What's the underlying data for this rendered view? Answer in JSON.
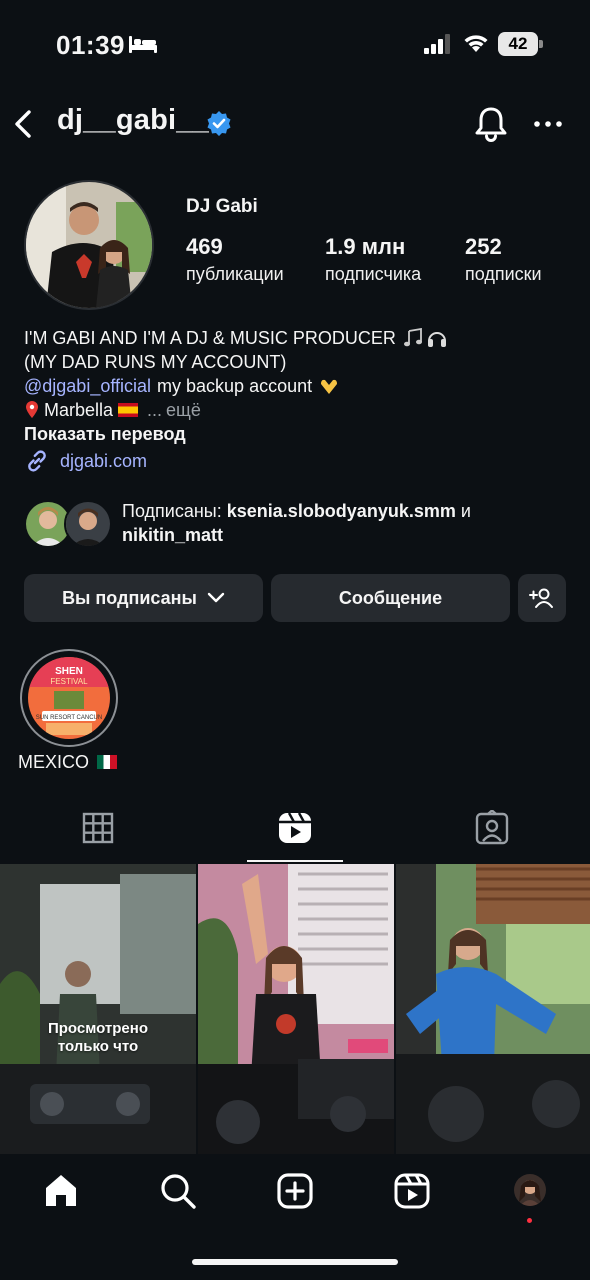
{
  "status_bar": {
    "time": "01:39",
    "battery": "42"
  },
  "header": {
    "username": "dj__gabi__"
  },
  "profile": {
    "display_name": "DJ Gabi",
    "stats": [
      {
        "value": "469",
        "label": "публикации"
      },
      {
        "value": "1.9 млн",
        "label": "подписчика"
      },
      {
        "value": "252",
        "label": "подписки"
      }
    ],
    "bio": {
      "line1": "I'M GABI AND I'M A DJ & MUSIC PRODUCER",
      "line2": "(MY DAD RUNS MY ACCOUNT)",
      "line3_mention": "@djgabi_official",
      "line3_text": "my backup account",
      "line4_location": "Marbella",
      "line4_more": "ещё",
      "translate": "Показать перевод"
    },
    "link": "djgabi.com",
    "followed_by": {
      "prefix": "Подписаны:",
      "user1": "ksenia.slobodyanyuk.smm",
      "conj": "и",
      "user2": "nikitin_matt"
    }
  },
  "actions": {
    "following_label": "Вы подписаны",
    "message_label": "Сообщение"
  },
  "highlights": [
    {
      "label": "MEXICO",
      "flag": "mexico"
    }
  ],
  "grid": {
    "items": [
      {
        "caption": "Просмотрено только что"
      },
      {
        "caption": ""
      },
      {
        "caption": ""
      }
    ]
  },
  "colors": {
    "background": "#0c1014",
    "button": "#262a2f",
    "mention": "#a6b4ff",
    "verified": "#3897f0",
    "notification_dot": "#ff3040"
  }
}
